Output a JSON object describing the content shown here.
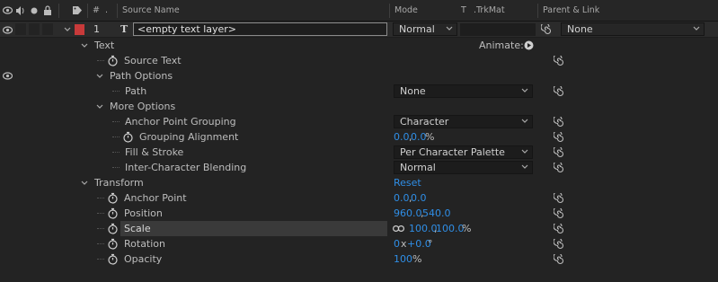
{
  "header": {
    "num": "#",
    "source_name": "Source Name",
    "mode": "Mode",
    "t": "T",
    "trkmat": ".TrkMat",
    "parent_link": "Parent & Link"
  },
  "layer": {
    "number": "1",
    "name": "<empty text layer>",
    "mode": "Normal",
    "parent": "None",
    "label_color": "#c83a3a"
  },
  "rows": {
    "text_group": "Text",
    "animate_label": "Animate:",
    "source_text": "Source Text",
    "path_options": "Path Options",
    "path": "Path",
    "path_value": "None",
    "more_options": "More Options",
    "anchor_point_grouping": "Anchor Point Grouping",
    "anchor_point_grouping_value": "Character",
    "grouping_alignment": "Grouping Alignment",
    "grouping_alignment_x": "0.0",
    "grouping_alignment_y": "0.0",
    "grouping_alignment_unit": "%",
    "fill_stroke": "Fill & Stroke",
    "fill_stroke_value": "Per Character Palette",
    "inter_character_blending": "Inter-Character Blending",
    "inter_character_blending_value": "Normal",
    "transform": "Transform",
    "reset": "Reset",
    "anchor_point": "Anchor Point",
    "anchor_point_x": "0.0",
    "anchor_point_y": "0.0",
    "position": "Position",
    "position_x": "960.0",
    "position_y": "540.0",
    "scale": "Scale",
    "scale_x": "100.0",
    "scale_y": "100.0",
    "scale_unit": "%",
    "rotation": "Rotation",
    "rotation_turns": "0",
    "rotation_x": "x",
    "rotation_degrees": "+0.0",
    "rotation_unit": "°",
    "opacity": "Opacity",
    "opacity_value": "100",
    "opacity_unit": "%",
    "comma": ","
  },
  "colors": {
    "value_blue": "#2f8ee6",
    "background": "#232323"
  }
}
